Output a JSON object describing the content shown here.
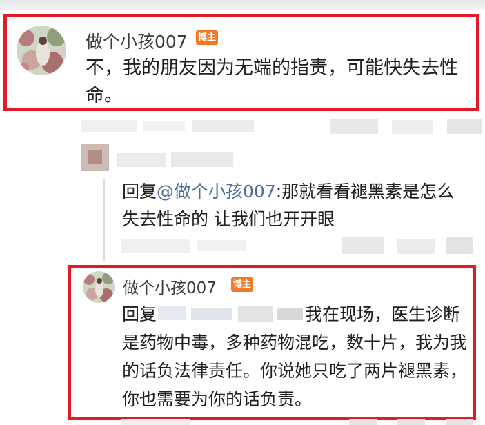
{
  "comment_main": {
    "username": "做个小孩007",
    "badge": "博主",
    "text": "不，我的朋友因为无端的指责，可能快失去性命。"
  },
  "reply_quote": {
    "prefix": "回复",
    "mention": "@做个小孩007",
    "text": ":那就看看褪黑素是怎么失去性命的 让我们也开开眼"
  },
  "comment_reply": {
    "username": "做个小孩007",
    "badge": "博主",
    "prefix": "回复",
    "text": "我在现场，医生诊断是药物中毒，多种药物混吃，数十片，我为我的话负法律责任。你说她只吃了两片褪黑素，你也需要为你的话负责。"
  },
  "colors": {
    "highlight_border": "#e21b2a",
    "badge_bg": "#f07a25",
    "mention": "#4d6e9b"
  }
}
